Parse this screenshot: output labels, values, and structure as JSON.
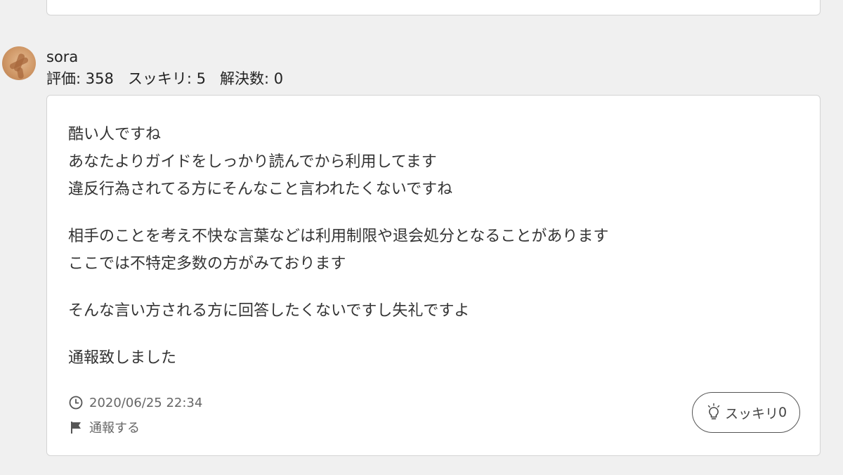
{
  "answer": {
    "user": {
      "name": "sora",
      "stats": {
        "rating": "評価: 358",
        "sukkiri": "スッキリ: 5",
        "solved": "解決数: 0"
      }
    },
    "body_lines": [
      "酷い人ですね",
      "あなたよりガイドをしっかり読んでから利用してます",
      "違反行為されてる方にそんなこと言われたくないですね",
      "相手のことを考え不快な言葉などは利用制限や退会処分となることがあります",
      "ここでは不特定多数の方がみております",
      "そんな言い方される方に回答したくないですし失礼ですよ",
      "通報致しました"
    ],
    "timestamp": "2020/06/25 22:34",
    "report_label": "通報する",
    "sukkiri_label": "スッキリ",
    "sukkiri_count": "0"
  },
  "icons": {
    "timestamp": "clock-icon",
    "report": "flag-icon",
    "sukkiri": "lightbulb-icon"
  }
}
